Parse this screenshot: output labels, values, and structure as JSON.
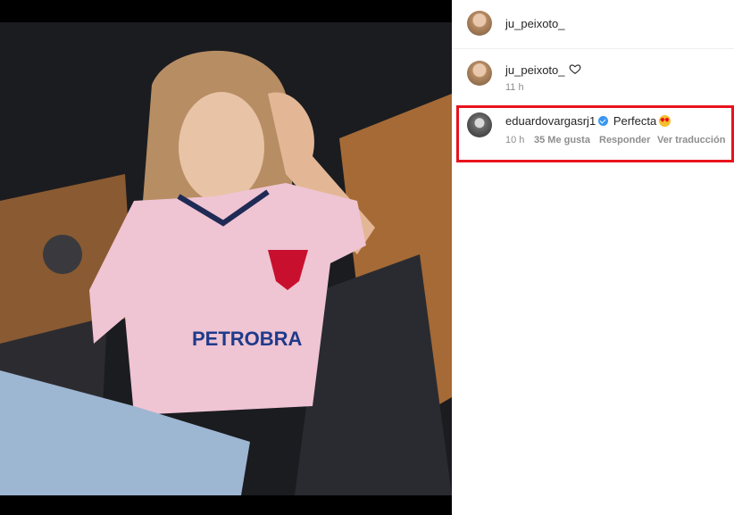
{
  "post": {
    "author": "ju_peixoto_",
    "caption_author": "ju_peixoto_",
    "caption_time": "11 h"
  },
  "comment": {
    "username": "eduardovargasrj1",
    "text": "Perfecta",
    "emoji": "heart-eyes-emoji",
    "time": "10 h",
    "likes": "35 Me gusta",
    "reply": "Responder",
    "translate": "Ver traducción"
  },
  "colors": {
    "highlight": "#e8131d",
    "verified": "#3897f0",
    "meta": "#8e8e8e",
    "text": "#262626"
  },
  "icons": [
    "heart-icon",
    "verified-badge-icon",
    "heart-eyes-emoji"
  ]
}
